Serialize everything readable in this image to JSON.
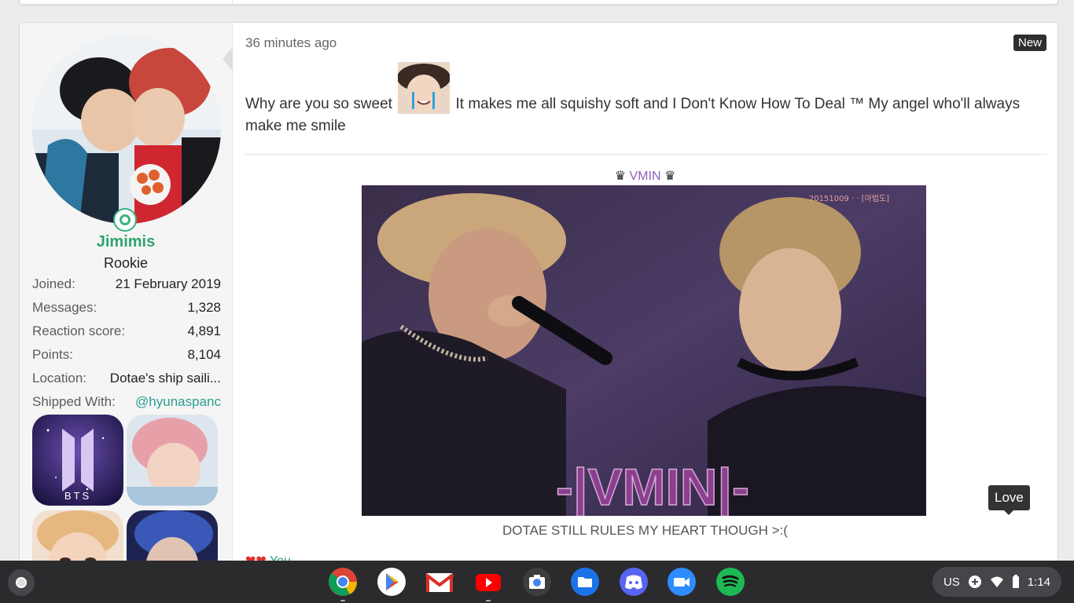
{
  "post": {
    "user": {
      "name": "Jimimis",
      "title": "Rookie",
      "stats": [
        {
          "key": "Joined:",
          "value": "21 February 2019"
        },
        {
          "key": "Messages:",
          "value": "1,328"
        },
        {
          "key": "Reaction score:",
          "value": "4,891"
        },
        {
          "key": "Points:",
          "value": "8,104"
        },
        {
          "key": "Location:",
          "value": "Dotae's ship saili..."
        },
        {
          "key": "Shipped With:",
          "value": "@hyunaspanc"
        }
      ],
      "badges": [
        "bts-logo-badge",
        "jimin-pink-hair-badge",
        "blonde-idol-badge",
        "blue-hair-idol-badge"
      ],
      "badge_text": "BTS"
    },
    "time": "36 minutes ago",
    "new_label": "New",
    "message_part1": "Why are you so sweet",
    "message_part2": "It makes me all squishy soft and I Don't Know How To Deal ™ My angel who'll always make me smile",
    "vmin_crown_left": "♛",
    "vmin_label": "VMIN",
    "vmin_crown_right": "♛",
    "gif_overlay_text": "-|VMIN|-",
    "gif_watermark": "20151009 · · [마법도]",
    "caption": "DOTAE STILL RULES MY HEART THOUGH >:(",
    "tooltip": "Love",
    "reactions_icons": "❤❤",
    "reactions": "You"
  },
  "shelf": {
    "apps": [
      "chrome-icon",
      "play-store-icon",
      "gmail-icon",
      "youtube-icon",
      "camera-icon",
      "files-icon",
      "discord-icon",
      "zoom-icon",
      "spotify-icon"
    ],
    "tray": {
      "input": "US",
      "time": "1:14"
    }
  },
  "colors": {
    "username": "#2fa46e",
    "vmin": "#8e5fb8",
    "link": "#2a9d8f",
    "shelf": "#2b2b2e"
  }
}
